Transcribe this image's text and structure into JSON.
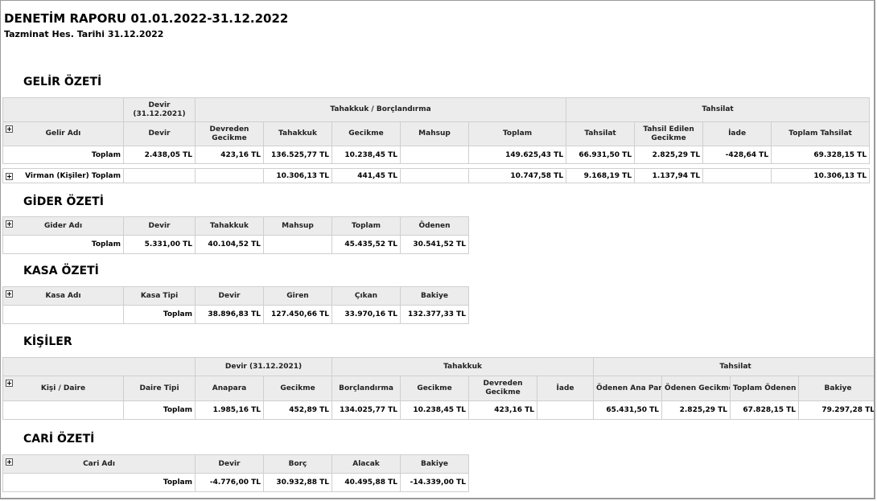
{
  "header": {
    "title": "DENETİM RAPORU 01.01.2022-31.12.2022",
    "subtitle": "Tazminat Hes. Tarihi 31.12.2022"
  },
  "gelir": {
    "title": "GELİR ÖZETİ",
    "group_devir": "Devir\n(31.12.2021)",
    "group_tahakkuk": "Tahakkuk / Borçlandırma",
    "group_tahsilat": "Tahsilat",
    "columns": [
      "Gelir Adı",
      "Devir",
      "Devreden\nGecikme",
      "Tahakkuk",
      "Gecikme",
      "Mahsup",
      "Toplam",
      "Tahsilat",
      "Tahsil Edilen\nGecikme",
      "İade",
      "Toplam Tahsilat"
    ],
    "rows": [
      [
        "Toplam",
        "2.438,05 TL",
        "423,16 TL",
        "136.525,77 TL",
        "10.238,45 TL",
        "",
        "149.625,43 TL",
        "66.931,50 TL",
        "2.825,29 TL",
        "-428,64 TL",
        "69.328,15 TL"
      ],
      [
        "Virman (Kişiler) Toplam",
        "",
        "",
        "10.306,13 TL",
        "441,45 TL",
        "",
        "10.747,58 TL",
        "9.168,19 TL",
        "1.137,94 TL",
        "",
        "10.306,13 TL"
      ]
    ]
  },
  "gider": {
    "title": "GİDER ÖZETİ",
    "columns": [
      "Gider Adı",
      "Devir",
      "Tahakkuk",
      "Mahsup",
      "Toplam",
      "Ödenen"
    ],
    "rows": [
      [
        "Toplam",
        "5.331,00 TL",
        "40.104,52 TL",
        "",
        "45.435,52 TL",
        "30.541,52 TL"
      ]
    ]
  },
  "kasa": {
    "title": "KASA ÖZETİ",
    "columns": [
      "Kasa Adı",
      "Kasa Tipi",
      "Devir",
      "Giren",
      "Çıkan",
      "Bakiye"
    ],
    "rows": [
      [
        "",
        "Toplam",
        "38.896,83 TL",
        "127.450,66 TL",
        "33.970,16 TL",
        "132.377,33 TL"
      ]
    ]
  },
  "kisiler": {
    "title": "KİŞİLER",
    "group_devir": "Devir (31.12.2021)",
    "group_tahakkuk": "Tahakkuk",
    "group_tahsilat": "Tahsilat",
    "columns": [
      "Kişi / Daire",
      "Daire Tipi",
      "Anapara",
      "Gecikme",
      "Borçlandırma",
      "Gecikme",
      "Devreden\nGecikme",
      "İade",
      "Ödenen Ana Para",
      "Ödenen Gecikme",
      "Toplam Ödenen",
      "Bakiye"
    ],
    "rows": [
      [
        "",
        "Toplam",
        "1.985,16 TL",
        "452,89 TL",
        "134.025,77 TL",
        "10.238,45 TL",
        "423,16 TL",
        "",
        "65.431,50 TL",
        "2.825,29 TL",
        "67.828,15 TL",
        "79.297,28 TL"
      ]
    ]
  },
  "cari": {
    "title": "CARİ ÖZETİ",
    "columns": [
      "Cari Adı",
      "Devir",
      "Borç",
      "Alacak",
      "Bakiye"
    ],
    "rows": [
      [
        "Toplam",
        "-4.776,00 TL",
        "30.932,88 TL",
        "40.495,88 TL",
        "-14.339,00 TL"
      ]
    ]
  }
}
